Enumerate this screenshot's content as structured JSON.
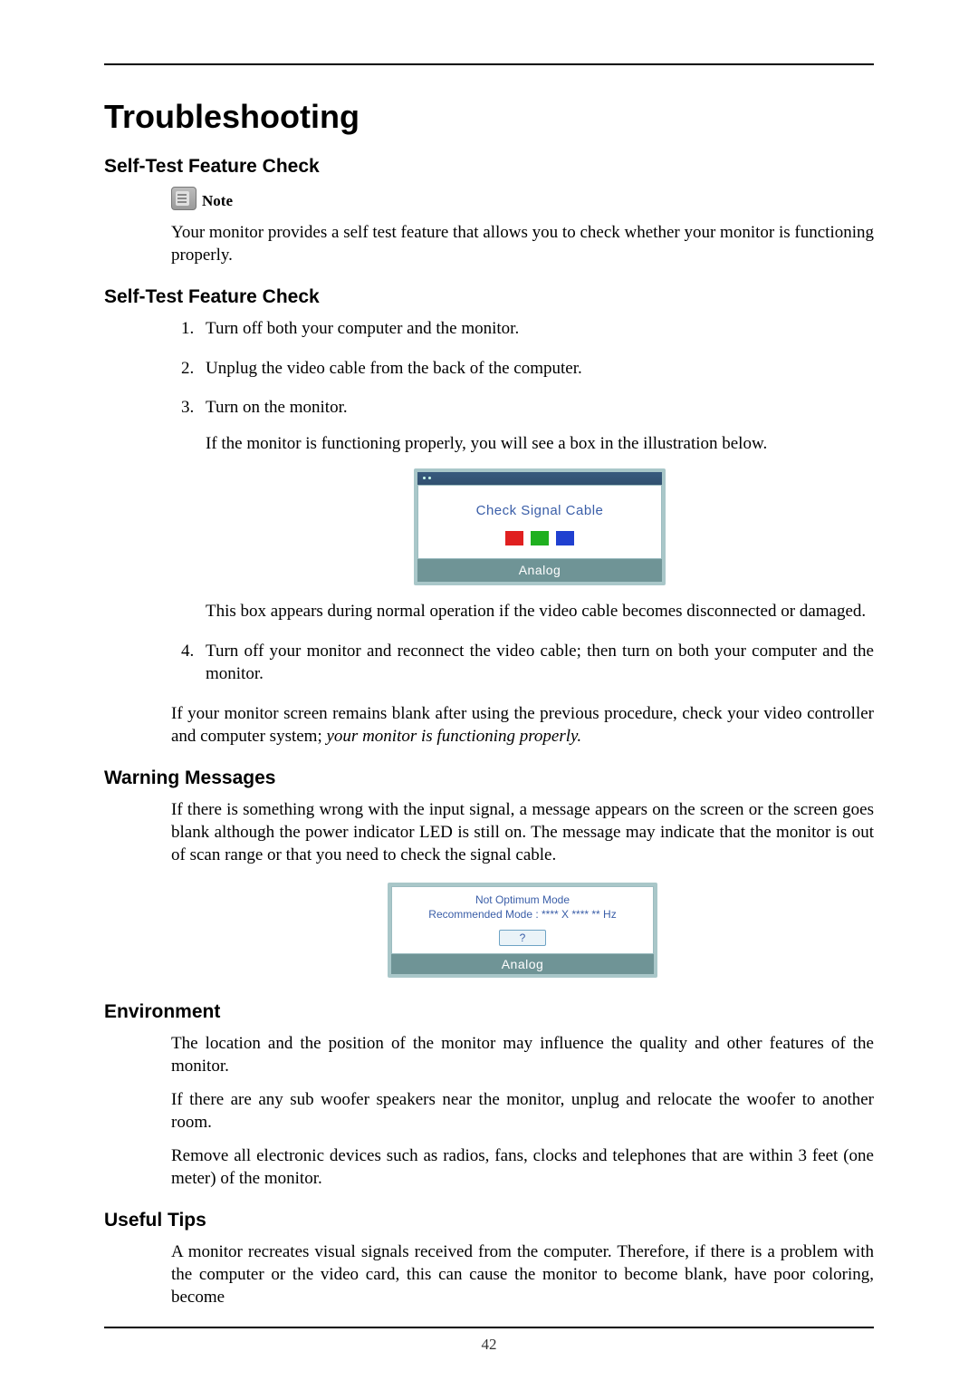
{
  "page_number": "42",
  "h1": "Troubleshooting",
  "sections": {
    "selfTest1": {
      "heading": "Self-Test Feature Check",
      "noteLabel": "Note",
      "noteBody": "Your monitor provides a self test feature that allows you to check whether your monitor is functioning properly."
    },
    "selfTest2": {
      "heading": "Self-Test Feature Check",
      "steps": {
        "s1": "Turn off both your computer and the monitor.",
        "s2": "Unplug the video cable from the back of the computer.",
        "s3": "Turn on the monitor.",
        "s3b": "If the monitor is functioning properly, you will see a box in the illustration below.",
        "s3c": "This box appears during normal operation if the video cable becomes disconnected or damaged.",
        "s4": "Turn off your monitor and reconnect the video cable; then turn on both your computer and the monitor."
      },
      "closing_a": "If your monitor screen remains blank after using the previous procedure, check your video controller and computer system; ",
      "closing_b": "your monitor is functioning properly."
    },
    "fig1": {
      "title": "Check Signal Cable",
      "footer": "Analog"
    },
    "warning": {
      "heading": "Warning Messages",
      "body": "If there is something wrong with the input signal, a message appears on the screen or the screen goes blank although the power indicator LED is still on. The message may indicate that the monitor is out of scan range or that you need to check the signal cable."
    },
    "fig2": {
      "line1": "Not Optimum Mode",
      "line2": "Recommended Mode : **** X **** ** Hz",
      "button": "?",
      "footer": "Analog"
    },
    "environment": {
      "heading": "Environment",
      "p1": "The location and the position of the monitor may influence the quality and other features of the monitor.",
      "p2": "If there are any sub woofer speakers near the monitor, unplug and relocate the woofer to another room.",
      "p3": "Remove all electronic devices such as radios, fans, clocks and telephones that are within 3 feet (one meter) of the monitor."
    },
    "tips": {
      "heading": "Useful Tips",
      "p1": "A monitor recreates visual signals received from the computer. Therefore, if there is a problem with the computer or the video card, this can cause the monitor to become blank, have poor coloring, become"
    }
  }
}
